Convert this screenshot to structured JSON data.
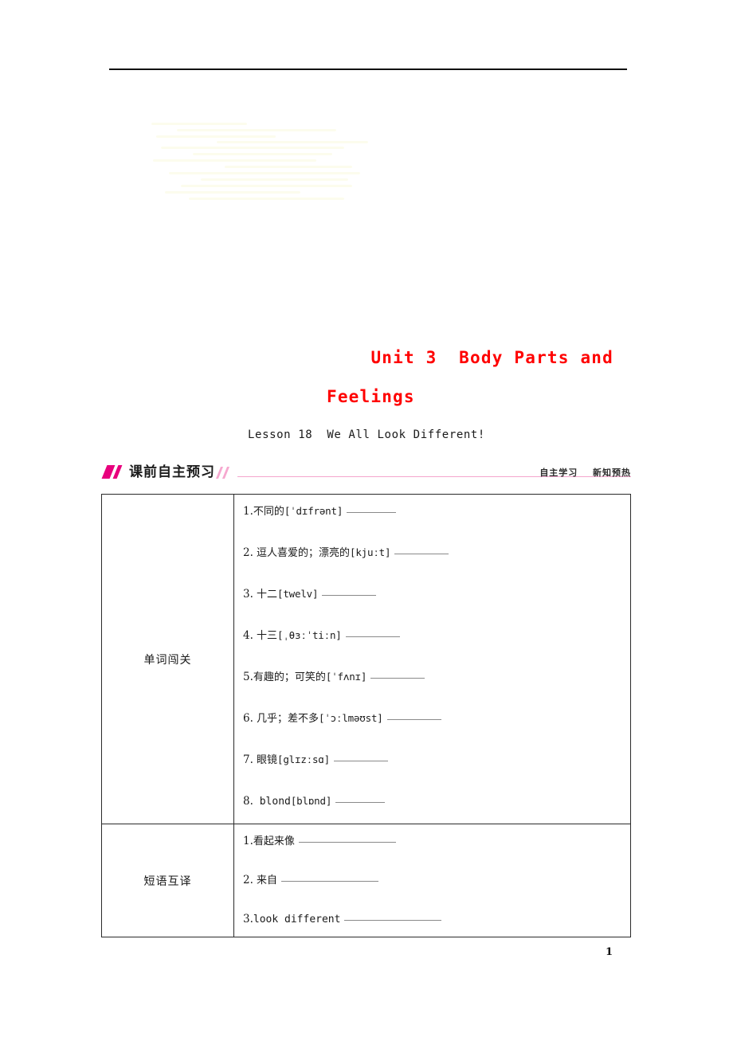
{
  "document": {
    "unit_title_line1": "Unit 3  Body Parts and",
    "unit_title_line2": "Feelings",
    "lesson_title": "Lesson 18  We All Look Different!",
    "page_number": "1",
    "title_color": "#ff0000",
    "accent_color": "#e8007d",
    "rule_color": "#f4a6cd"
  },
  "banner": {
    "title": "课前自主预习",
    "right_text_1": "自主学习",
    "right_text_2": "新知预热"
  },
  "table": {
    "rows": [
      {
        "label": "单词闯关",
        "items": [
          {
            "num": "1.",
            "cn": "不同的",
            "ipa": "[ˈdɪfrənt]",
            "blank": "short"
          },
          {
            "num": "2.",
            "cn": " 逗人喜爱的；漂亮的",
            "ipa": "[kjuːt]",
            "blank": "med"
          },
          {
            "num": "3.",
            "cn": " 十二",
            "ipa": "[twelv]",
            "blank": "med"
          },
          {
            "num": "4.",
            "cn": " 十三",
            "ipa": "[ˌθɜːˈtiːn]",
            "blank": "med"
          },
          {
            "num": "5.",
            "cn": "有趣的；可笑的",
            "ipa": "[ˈfʌnɪ]",
            "blank": "med"
          },
          {
            "num": "6.",
            "cn": " 几乎；差不多",
            "ipa": "[ˈɔːlməʊst]",
            "blank": "med"
          },
          {
            "num": "7.",
            "cn": " 眼镜",
            "ipa": "[glɪzːsɑ]",
            "blank": "med"
          },
          {
            "num": "8.",
            "en": " blond",
            "ipa": "[blɒnd]",
            "blank": "short"
          }
        ]
      },
      {
        "label": "短语互译",
        "items": [
          {
            "num": "1.",
            "cn": "看起来像",
            "blank": "long"
          },
          {
            "num": "2.",
            "cn": " 来自",
            "blank": "long"
          },
          {
            "num": "3.",
            "en": "look different",
            "blank": "long"
          }
        ]
      }
    ]
  }
}
